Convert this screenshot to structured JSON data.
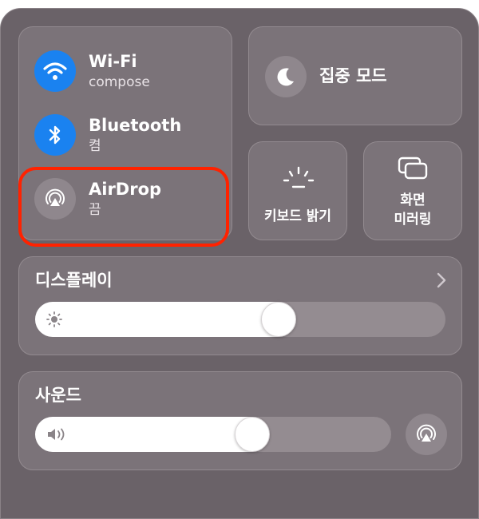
{
  "connectivity": {
    "wifi": {
      "title": "Wi-Fi",
      "status": "compose"
    },
    "bluetooth": {
      "title": "Bluetooth",
      "status": "켬"
    },
    "airdrop": {
      "title": "AirDrop",
      "status": "끔"
    }
  },
  "focus": {
    "label": "집중 모드"
  },
  "keyboard_brightness": {
    "label": "키보드 밝기"
  },
  "screen_mirroring": {
    "line1": "화면",
    "line2": "미러링"
  },
  "display": {
    "title": "디스플레이",
    "brightness_level": 0.6
  },
  "sound": {
    "title": "사운드",
    "volume_level": 0.62
  },
  "colors": {
    "accent": "#1a82f0",
    "highlight": "#ff2200"
  }
}
